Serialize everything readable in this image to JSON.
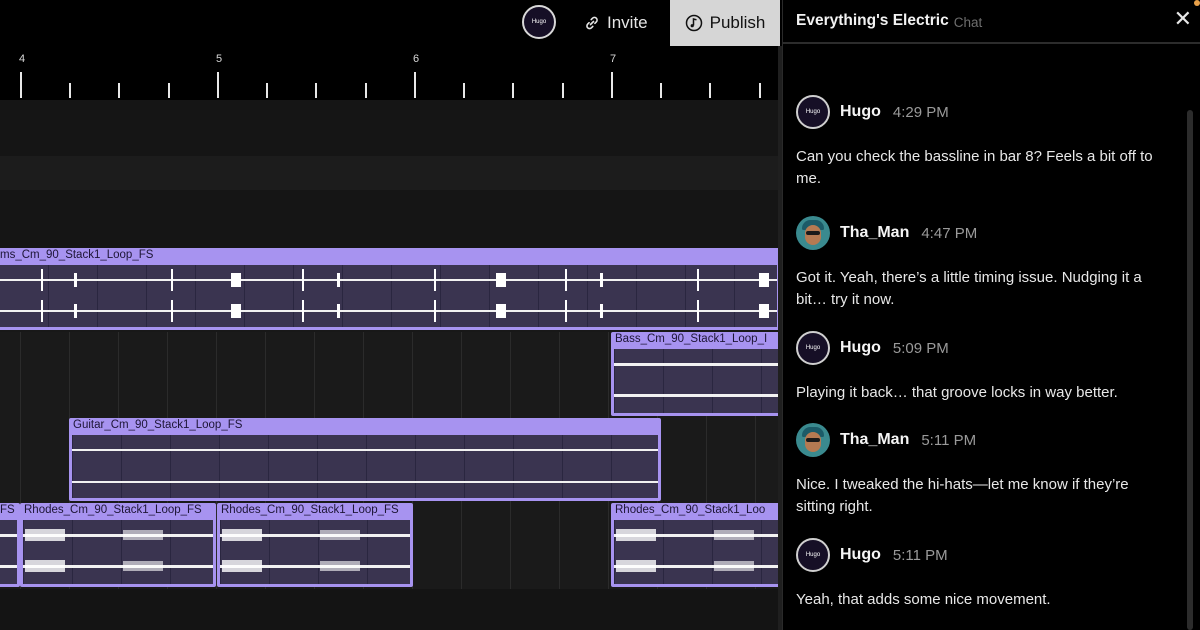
{
  "topbar": {
    "avatar_label": "Hugo",
    "invite_label": "Invite",
    "publish_label": "Publish",
    "invite_icon": "link-icon",
    "publish_icon": "music-note-icon"
  },
  "ruler": {
    "bar_numbers": [
      "4",
      "5",
      "6",
      "7"
    ]
  },
  "tracks": {
    "drums_region": "ms_Cm_90_Stack1_Loop_FS",
    "bass_region": "Bass_Cm_90_Stack1_Loop_I",
    "guitar_region": "Guitar_Cm_90_Stack1_Loop_FS",
    "rhodes_regions": [
      "FS",
      "Rhodes_Cm_90_Stack1_Loop_FS",
      "Rhodes_Cm_90_Stack1_Loop_FS",
      "Rhodes_Cm_90_Stack1_Loo"
    ]
  },
  "colors": {
    "region": "#a793f0",
    "region_body": "#3a3450",
    "accent_dot": "#e8a14a"
  },
  "chat": {
    "title": "Everything's Electric",
    "subtitle": "Chat",
    "close_icon": "close-icon",
    "messages": [
      {
        "author": "Hugo",
        "time": "4:29 PM",
        "text": "Can you check the bassline in bar 8? Feels a bit off to me."
      },
      {
        "author": "Tha_Man",
        "time": "4:47 PM",
        "text": "Got it. Yeah, there’s a little timing issue. Nudging it a bit… try it now."
      },
      {
        "author": "Hugo",
        "time": "5:09 PM",
        "text": "Playing it back… that groove locks in way better."
      },
      {
        "author": "Tha_Man",
        "time": "5:11 PM",
        "text": "Nice. I tweaked the hi-hats—let me know if they’re sitting right."
      },
      {
        "author": "Hugo",
        "time": "5:11 PM",
        "text": "Yeah, that adds some nice movement."
      }
    ]
  }
}
